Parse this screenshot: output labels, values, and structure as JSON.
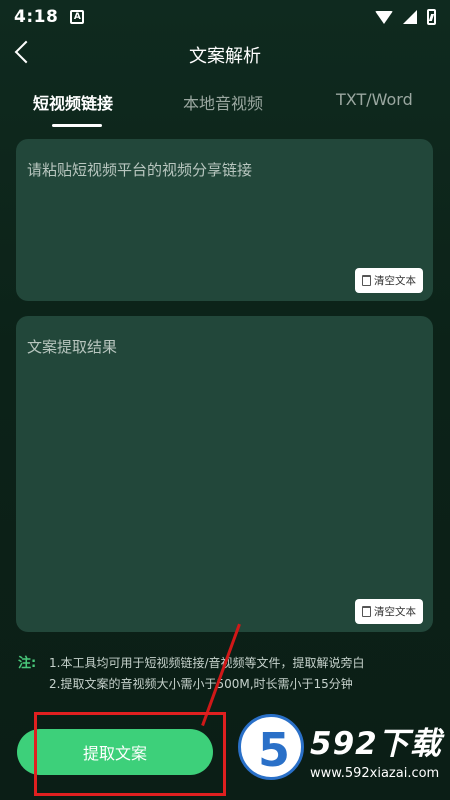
{
  "status_bar": {
    "time": "4:18",
    "a_badge": "A"
  },
  "header": {
    "title": "文案解析"
  },
  "tabs": [
    {
      "label": "短视频链接",
      "active": true
    },
    {
      "label": "本地音视频",
      "active": false
    },
    {
      "label": "TXT/Word",
      "active": false
    }
  ],
  "input_panel": {
    "placeholder": "请粘贴短视频平台的视频分享链接",
    "clear_label": "清空文本"
  },
  "result_panel": {
    "placeholder": "文案提取结果",
    "clear_label": "清空文本"
  },
  "notes": {
    "tag": "注:",
    "lines": [
      "1.本工具均可用于短视频链接/音视频等文件，提取解说旁白",
      "2.提取文案的音视频大小需小于500M,时长需小于15分钟"
    ]
  },
  "actions": {
    "extract_label": "提取文案"
  },
  "watermark": {
    "badge": "5",
    "brand": "592下载",
    "url": "www.592xiazai.com"
  },
  "colors": {
    "accent": "#3dd07a",
    "panel": "#22473a",
    "annotation": "#e02020"
  }
}
